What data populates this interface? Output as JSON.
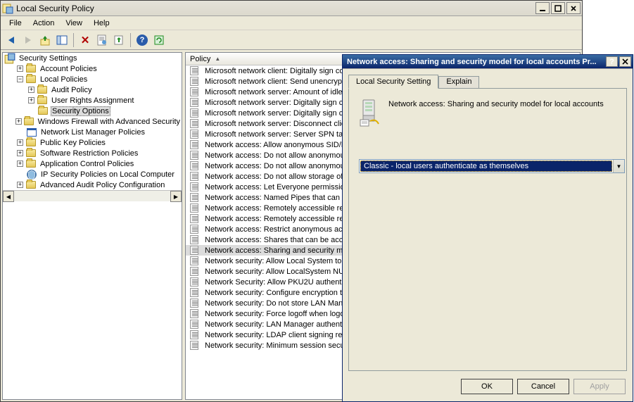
{
  "window": {
    "title": "Local Security Policy",
    "menus": [
      "File",
      "Action",
      "View",
      "Help"
    ]
  },
  "tree": {
    "root": "Security Settings",
    "nodes": [
      {
        "label": "Account Policies",
        "icon": "folder",
        "exp": "plus",
        "depth": 1
      },
      {
        "label": "Local Policies",
        "icon": "folder",
        "exp": "minus",
        "depth": 1
      },
      {
        "label": "Audit Policy",
        "icon": "folder",
        "exp": "plus",
        "depth": 2
      },
      {
        "label": "User Rights Assignment",
        "icon": "folder",
        "exp": "plus",
        "depth": 2
      },
      {
        "label": "Security Options",
        "icon": "folder",
        "exp": "none",
        "depth": 2,
        "selected": true
      },
      {
        "label": "Windows Firewall with Advanced Security",
        "icon": "folder",
        "exp": "plus",
        "depth": 1
      },
      {
        "label": "Network List Manager Policies",
        "icon": "app",
        "exp": "none",
        "depth": 1
      },
      {
        "label": "Public Key Policies",
        "icon": "folder",
        "exp": "plus",
        "depth": 1
      },
      {
        "label": "Software Restriction Policies",
        "icon": "folder",
        "exp": "plus",
        "depth": 1
      },
      {
        "label": "Application Control Policies",
        "icon": "folder",
        "exp": "plus",
        "depth": 1
      },
      {
        "label": "IP Security Policies on Local Computer",
        "icon": "sec",
        "exp": "none",
        "depth": 1
      },
      {
        "label": "Advanced Audit Policy Configuration",
        "icon": "folder",
        "exp": "plus",
        "depth": 1
      }
    ]
  },
  "list": {
    "header": "Policy",
    "items": [
      "Microsoft network client: Digitally sign com",
      "Microsoft network client: Send unencrypte",
      "Microsoft network server: Amount of idle t",
      "Microsoft network server: Digitally sign con",
      "Microsoft network server: Digitally sign con",
      "Microsoft network server: Disconnect clien",
      "Microsoft network server: Server SPN targ",
      "Network access: Allow anonymous SID/Na",
      "Network access: Do not allow anonymous e",
      "Network access: Do not allow anonymous e",
      "Network access: Do not allow storage of p",
      "Network access: Let Everyone permissions",
      "Network access: Named Pipes that can be",
      "Network access: Remotely accessible regis",
      "Network access: Remotely accessible regis",
      "Network access: Restrict anonymous acces",
      "Network access: Shares that can be acces",
      "Network access: Sharing and security mod",
      "Network security: Allow Local System to us",
      "Network security: Allow LocalSystem NULL",
      "Network Security: Allow PKU2U authentica",
      "Network security: Configure encryption typ",
      "Network security: Do not store LAN Manag",
      "Network security: Force logoff when logon",
      "Network security: LAN Manager authentica",
      "Network security: LDAP client signing requi",
      "Network security: Minimum session security"
    ],
    "selected_index": 17
  },
  "dialog": {
    "title": "Network access: Sharing and security model for local accounts Pr...",
    "tabs": [
      "Local Security Setting",
      "Explain"
    ],
    "active_tab": 0,
    "heading": "Network access: Sharing and security model for local accounts",
    "dropdown_value": "Classic - local users authenticate as themselves",
    "buttons": {
      "ok": "OK",
      "cancel": "Cancel",
      "apply": "Apply"
    }
  }
}
